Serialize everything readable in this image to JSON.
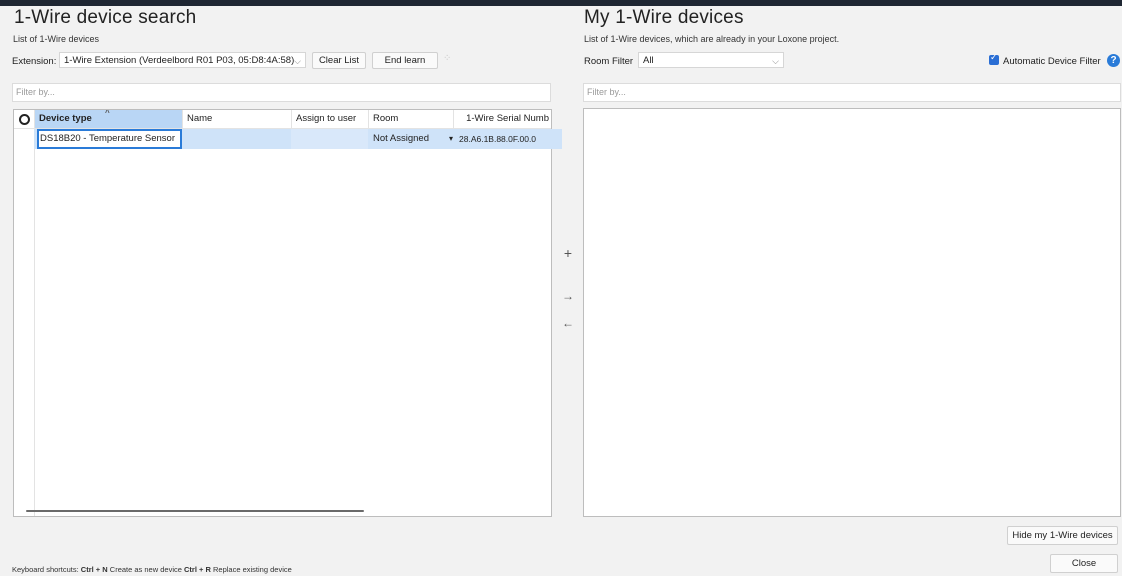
{
  "left": {
    "title": "1-Wire device search",
    "subtitle": "List of 1-Wire devices",
    "extension_label": "Extension:",
    "extension_value": "1-Wire Extension (Verdeelbord R01 P03, 05:D8:4A:58)",
    "clear_list": "Clear List",
    "end_learn": "End learn",
    "filter_placeholder": "Filter by...",
    "table": {
      "columns": [
        "Device type",
        "Name",
        "Assign to user",
        "Room",
        "1-Wire Serial Numb"
      ],
      "rows": [
        {
          "device_type": "DS18B20 - Temperature Sensor",
          "name": "",
          "assign_to_user": "",
          "room": "Not Assigned",
          "serial": "28.A6.1B.88.0F.00.0"
        }
      ]
    }
  },
  "right": {
    "title": "My 1-Wire devices",
    "subtitle": "List of 1-Wire devices, which are already in your Loxone project.",
    "room_filter_label": "Room Filter",
    "room_filter_value": "All",
    "auto_filter_label": "Automatic Device Filter",
    "filter_placeholder": "Filter by...",
    "hide_button": "Hide my 1-Wire devices",
    "close_button": "Close"
  },
  "middle": {
    "add": "+",
    "move_right": "→",
    "move_left": "←"
  },
  "footer": {
    "prefix": "Keyboard shortcuts:",
    "key1": "Ctrl + N",
    "action1": "Create as new device",
    "key2": "Ctrl + R",
    "action2": "Replace existing device"
  },
  "colors": {
    "accent": "#2a7bd8",
    "selected_row": "#cfe3f9"
  }
}
